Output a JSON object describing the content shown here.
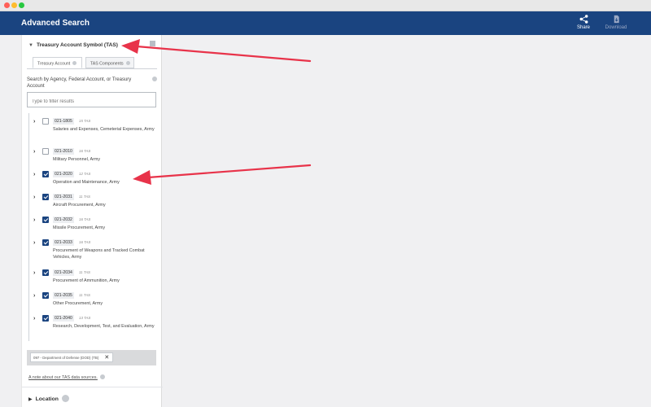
{
  "window": {
    "controls": [
      {
        "name": "close",
        "color": "#ff5f57"
      },
      {
        "name": "minimize",
        "color": "#febc2e"
      },
      {
        "name": "zoom",
        "color": "#28c840"
      }
    ]
  },
  "header": {
    "title": "Advanced Search",
    "background": "#1a4480",
    "share_label": "Share",
    "download_label": "Download"
  },
  "sidebar": {
    "section_title": "Treasury Account Symbol (TAS)",
    "tabs": [
      {
        "label": "Treasury Account",
        "active": true
      },
      {
        "label": "TAS Components",
        "active": false
      }
    ],
    "search_label": "Search by Agency, Federal Account, or Treasury Account",
    "filter_placeholder": "Type to filter results",
    "tree": [
      {
        "code": "021-1805",
        "count": "15 TAS",
        "desc": "Salaries and Expenses, Cemeterial Expenses, Army",
        "checked": false
      },
      {
        "code": "021-2010",
        "count": "16 TAS",
        "desc": "Military Personnel, Army",
        "checked": false
      },
      {
        "code": "021-2020",
        "count": "12 TAS",
        "desc": "Operation and Maintenance, Army",
        "checked": true
      },
      {
        "code": "021-2031",
        "count": "11 TAS",
        "desc": "Aircraft Procurement, Army",
        "checked": true
      },
      {
        "code": "021-2032",
        "count": "16 TAS",
        "desc": "Missile Procurement, Army",
        "checked": true
      },
      {
        "code": "021-2033",
        "count": "16 TAS",
        "desc": "Procurement of Weapons and Tracked Combat Vehicles, Army",
        "checked": true
      },
      {
        "code": "021-2034",
        "count": "11 TAS",
        "desc": "Procurement of Ammunition, Army",
        "checked": true
      },
      {
        "code": "021-2035",
        "count": "11 TAS",
        "desc": "Other Procurement, Army",
        "checked": true
      },
      {
        "code": "021-2040",
        "count": "13 TAS",
        "desc": "Research, Development, Test, and Evaluation, Army",
        "checked": true
      }
    ],
    "selected_chip": "097 - Department of Defense (DOD) (TB)",
    "note_link": "A note about our TAS data sources.",
    "next_section": "Location"
  },
  "annotation_color": "#e8334a"
}
